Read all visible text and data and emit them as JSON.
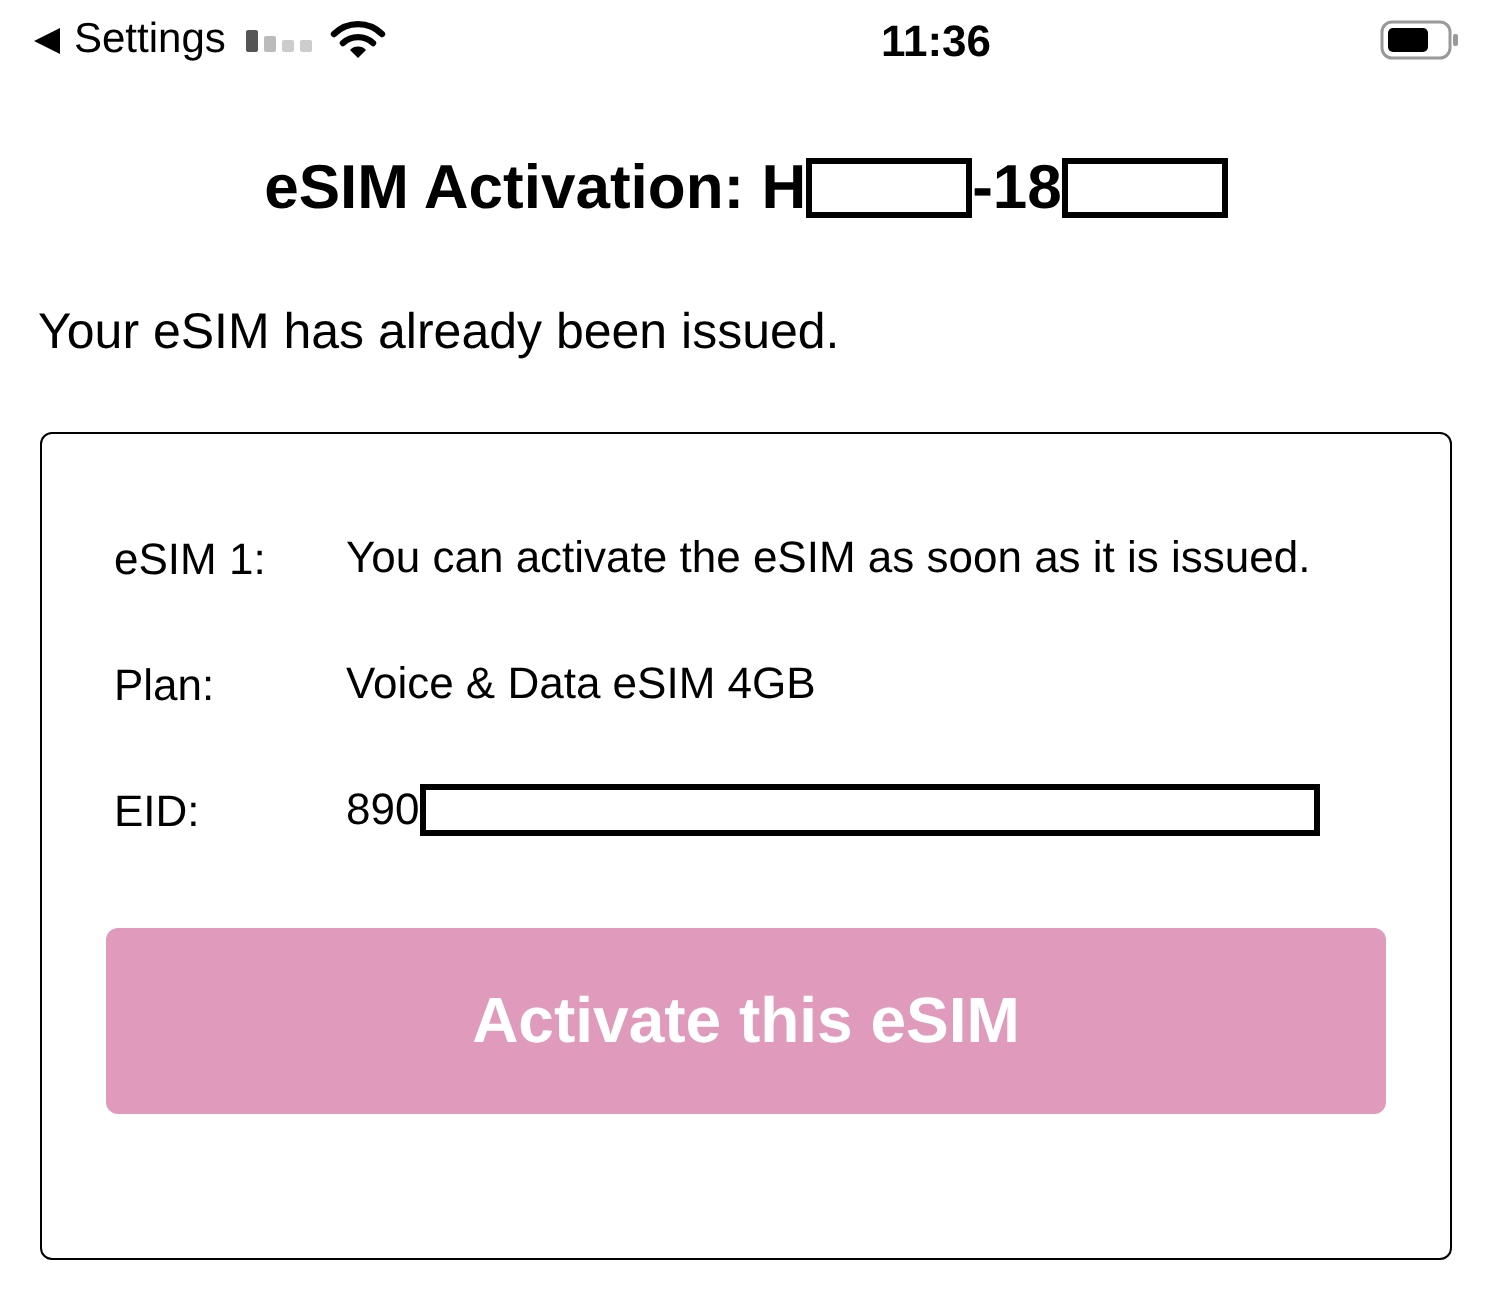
{
  "status_bar": {
    "back_label": "Settings",
    "time": "11:36"
  },
  "title": [
    {
      "kind": "text",
      "text": "eSIM Activation: H"
    },
    {
      "kind": "redacted"
    },
    {
      "kind": "text",
      "text": "-18"
    },
    {
      "kind": "redacted"
    }
  ],
  "message": "Your eSIM has already been issued.",
  "card": {
    "rows": [
      {
        "label": "eSIM 1:",
        "value": [
          {
            "kind": "text",
            "text": "You can activate the eSIM as soon as it is issued."
          }
        ]
      },
      {
        "label": "Plan:",
        "value": [
          {
            "kind": "text",
            "text": "Voice & Data eSIM 4GB"
          }
        ]
      },
      {
        "label": "EID:",
        "value": [
          {
            "kind": "text",
            "text": "890"
          },
          {
            "kind": "redacted"
          }
        ]
      }
    ],
    "button": {
      "label": "Activate this eSIM",
      "disabled": true
    }
  }
}
